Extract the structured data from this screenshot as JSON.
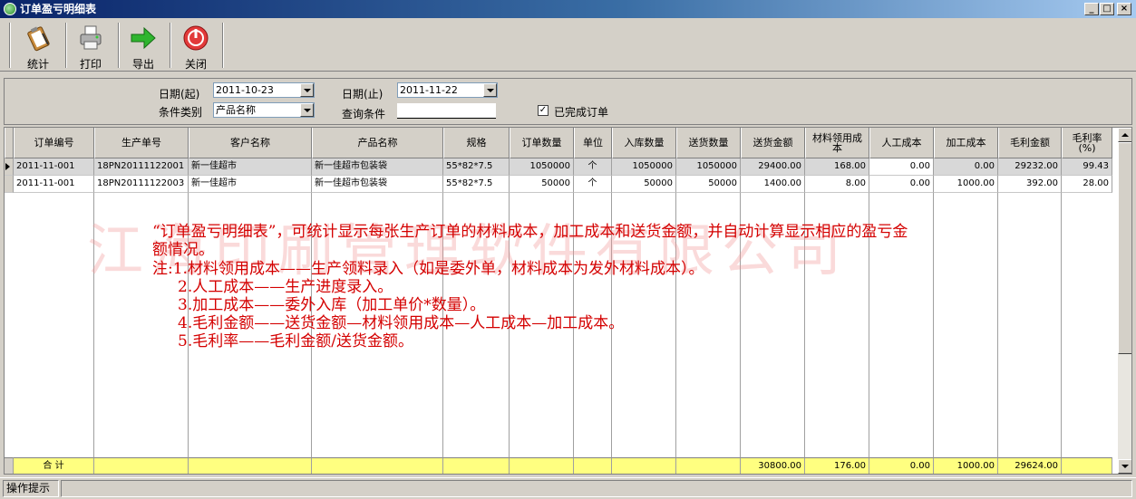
{
  "window": {
    "title": "订单盈亏明细表"
  },
  "toolbar": {
    "buttons": [
      {
        "label": "统计",
        "icon": "clipboard-icon"
      },
      {
        "label": "打印",
        "icon": "printer-icon"
      },
      {
        "label": "导出",
        "icon": "green-arrow-icon"
      },
      {
        "label": "关闭",
        "icon": "power-icon"
      }
    ]
  },
  "filter": {
    "date_from_label": "日期(起)",
    "date_from_value": "2011-10-23",
    "date_to_label": "日期(止)",
    "date_to_value": "2011-11-22",
    "category_label": "条件类别",
    "category_value": "产品名称",
    "query_label": "查询条件",
    "query_value": "",
    "completed_label": "已完成订单",
    "completed_checked": "✓"
  },
  "grid": {
    "columns": [
      "订单编号",
      "生产单号",
      "客户名称",
      "产品名称",
      "规格",
      "订单数量",
      "单位",
      "入库数量",
      "送货数量",
      "送货金额",
      "材料领用成本",
      "人工成本",
      "加工成本",
      "毛利金额",
      "毛利率(%)"
    ],
    "rows": [
      [
        "2011-11-001",
        "18PN20111122001",
        "新一佳超市",
        "新一佳超市包装袋",
        "55*82*7.5",
        "1050000",
        "个",
        "1050000",
        "1050000",
        "29400.00",
        "168.00",
        "0.00",
        "0.00",
        "29232.00",
        "99.43"
      ],
      [
        "2011-11-001",
        "18PN20111122003",
        "新一佳超市",
        "新一佳超市包装袋",
        "55*82*7.5",
        "50000",
        "个",
        "50000",
        "50000",
        "1400.00",
        "8.00",
        "0.00",
        "1000.00",
        "392.00",
        "28.00"
      ]
    ],
    "total_label": "合 计",
    "totals": {
      "delivery_amount": "30800.00",
      "material_cost": "176.00",
      "labor_cost": "0.00",
      "processing_cost": "1000.00",
      "gross_profit": "29624.00"
    }
  },
  "watermark": "江海印刷管理软件有限公司",
  "annotation": {
    "line1": "“订单盈亏明细表”，可统计显示每张生产订单的材料成本，加工成本和送货金额，并自动计算显示相应的盈亏金",
    "line2": "额情况。",
    "line3": "注:1.材料领用成本——生产领料录入（如是委外单，材料成本为发外材料成本）。",
    "line4": "2.人工成本——生产进度录入。",
    "line5": "3.加工成本——委外入库（加工单价*数量）。",
    "line6": "4.毛利金额——送货金额—材料领用成本—人工成本—加工成本。",
    "line7": "5.毛利率——毛利金额/送货金额。"
  },
  "status": {
    "hint_label": "操作提示"
  }
}
